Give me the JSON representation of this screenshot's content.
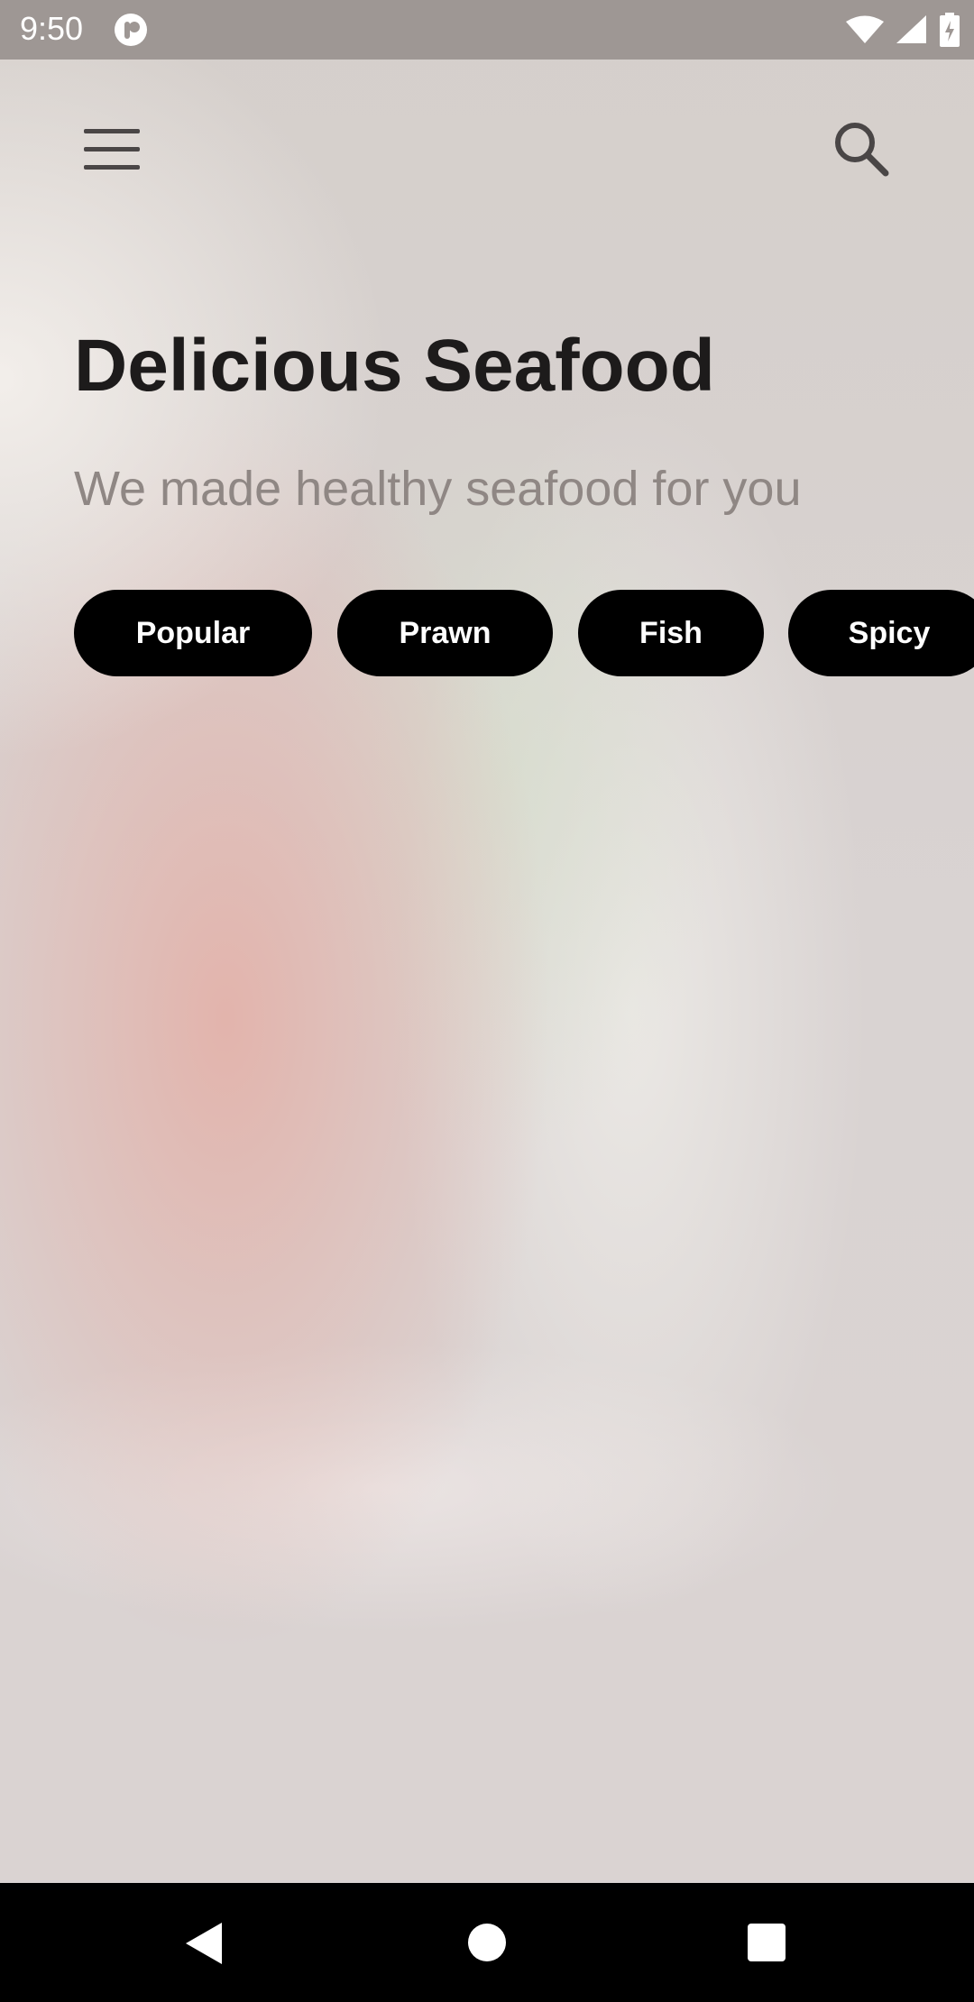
{
  "status_bar": {
    "time": "9:50",
    "icons": [
      "app-notification-icon",
      "wifi-icon",
      "signal-icon",
      "battery-charging-icon"
    ]
  },
  "app_bar": {
    "menu_icon": "hamburger-menu-icon",
    "search_icon": "search-icon"
  },
  "header": {
    "title": "Delicious Seafood",
    "subtitle": "We made healthy seafood for you"
  },
  "categories": [
    {
      "label": "Popular"
    },
    {
      "label": "Prawn"
    },
    {
      "label": "Fish"
    },
    {
      "label": "Spicy"
    }
  ],
  "nav_bar": {
    "icons": [
      "back-icon",
      "home-icon",
      "recents-icon"
    ]
  },
  "colors": {
    "chip_background": "#000000",
    "chip_text": "#ffffff",
    "title_text": "#1d1b1b",
    "subtitle_text": "#8f8784"
  }
}
